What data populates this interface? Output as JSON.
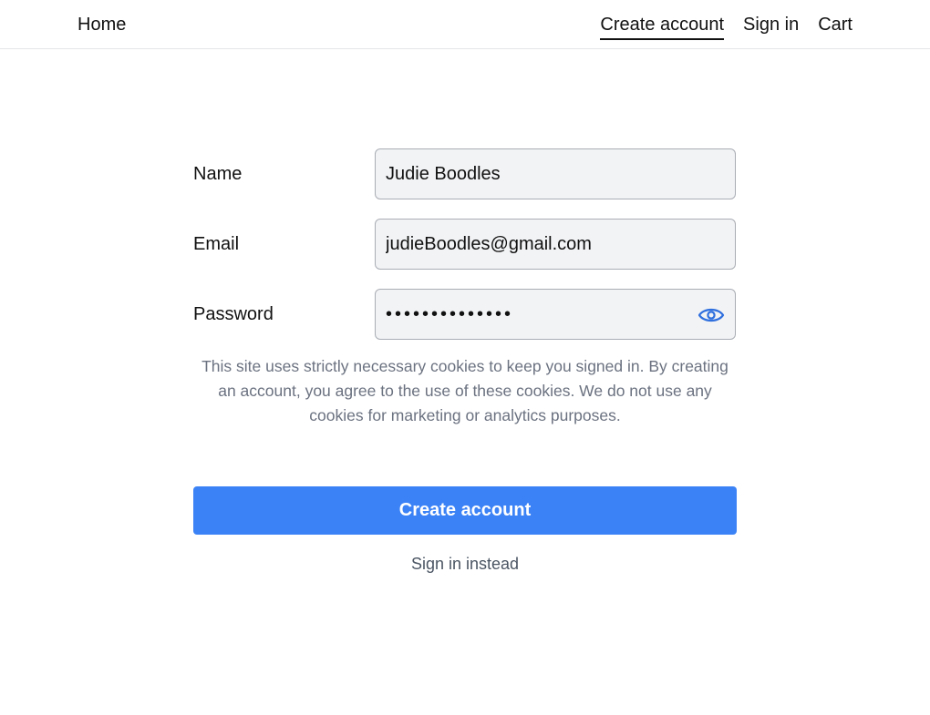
{
  "nav": {
    "home": "Home",
    "create_account": "Create account",
    "sign_in": "Sign in",
    "cart": "Cart"
  },
  "form": {
    "name_label": "Name",
    "name_value": "Judie Boodles",
    "email_label": "Email",
    "email_value": "judieBoodles@gmail.com",
    "password_label": "Password",
    "password_value": "••••••••••••••",
    "password_toggle_icon": "eye-icon"
  },
  "notice": "This site uses strictly necessary cookies to keep you signed in. By creating an account, you agree to the use of these cookies. We do not use any cookies for marketing or analytics purposes.",
  "actions": {
    "submit_label": "Create account",
    "alt_label": "Sign in instead"
  },
  "colors": {
    "accent": "#3b82f6",
    "eye_icon": "#2f6fde",
    "muted_text": "#6b7280"
  }
}
